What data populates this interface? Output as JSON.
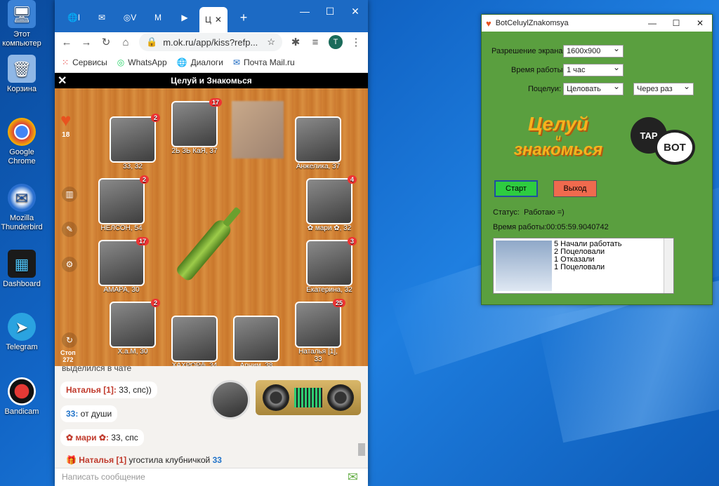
{
  "desktop": {
    "icons": [
      {
        "label": "Этот компьютер",
        "glyph": "🖥"
      },
      {
        "label": "Корзина",
        "glyph": "🗑"
      },
      {
        "label": "Google Chrome",
        "glyph": "◉"
      },
      {
        "label": "Mozilla Thunderbird",
        "glyph": "✉"
      },
      {
        "label": "Dashboard",
        "glyph": "▦"
      },
      {
        "label": "Telegram",
        "glyph": "➤"
      },
      {
        "label": "Bandicam",
        "glyph": "●"
      }
    ]
  },
  "browser": {
    "tabs": [
      "l",
      "V",
      "M",
      "Ц"
    ],
    "url": "m.ok.ru/app/kiss?refp...",
    "profile_initial": "T",
    "bookmarks": [
      "Сервисы",
      "WhatsApp",
      "Диалоги",
      "Почта Mail.ru"
    ],
    "game": {
      "title": "Целуй и Знакомься",
      "hearts": "18",
      "stop_label": "Стоп",
      "stop_count": "272",
      "players": [
        {
          "name": "33, 32",
          "badge": "2"
        },
        {
          "name": "2Ь 3Ь КаЯ, 37",
          "badge": "17"
        },
        {
          "name": "Анжелика, 37",
          "badge": ""
        },
        {
          "name": "НЕЛСОН, 54",
          "badge": "2"
        },
        {
          "name": "✿ мари ✿, 32",
          "badge": "4"
        },
        {
          "name": "АМАРА, 30",
          "badge": "17"
        },
        {
          "name": "Екатерина, 32",
          "badge": "3"
        },
        {
          "name": "Х.а.М, 30",
          "badge": "2"
        },
        {
          "name": "ХАХРОР╬, 34",
          "badge": ""
        },
        {
          "name": "Арним, 38",
          "badge": ""
        },
        {
          "name": "Наталья [1], 33",
          "badge": "25"
        }
      ]
    },
    "chat": {
      "clipped": "выделился в чате",
      "messages": [
        {
          "name": "Наталья [1]:",
          "text": " 33, спс))"
        },
        {
          "name": "33:",
          "text": " от души"
        },
        {
          "name": "✿ мари ✿:",
          "text": " 33, спс"
        },
        {
          "name": "🎁 Наталья [1]",
          "text": " угостила клубничкой ",
          "target": "33"
        }
      ],
      "placeholder": "Написать сообщение"
    }
  },
  "bot": {
    "title": "BotCeluylZnakomsya",
    "resolution_label": "Разрешение экрана:",
    "resolution_value": "1600x900",
    "worktime_label": "Время работы:",
    "worktime_value": "1 час",
    "kiss_label": "Поцелуи:",
    "kiss_value": "Целовать",
    "kiss_mode": "Через раз",
    "logo_line1": "Целуй",
    "logo_line2": "и",
    "logo_line3": "знакомься",
    "logo_bot": "BOT",
    "logo_tap": "TAP",
    "start": "Старт",
    "exit": "Выход",
    "status_label": "Статус:",
    "status_value": "Работаю =)",
    "elapsed_label": "Время работы:",
    "elapsed_value": "00:05:59.9040742",
    "log": [
      "5 Начали работать",
      "2 Поцеловали",
      "1 Отказали",
      "1 Поцеловали"
    ]
  }
}
